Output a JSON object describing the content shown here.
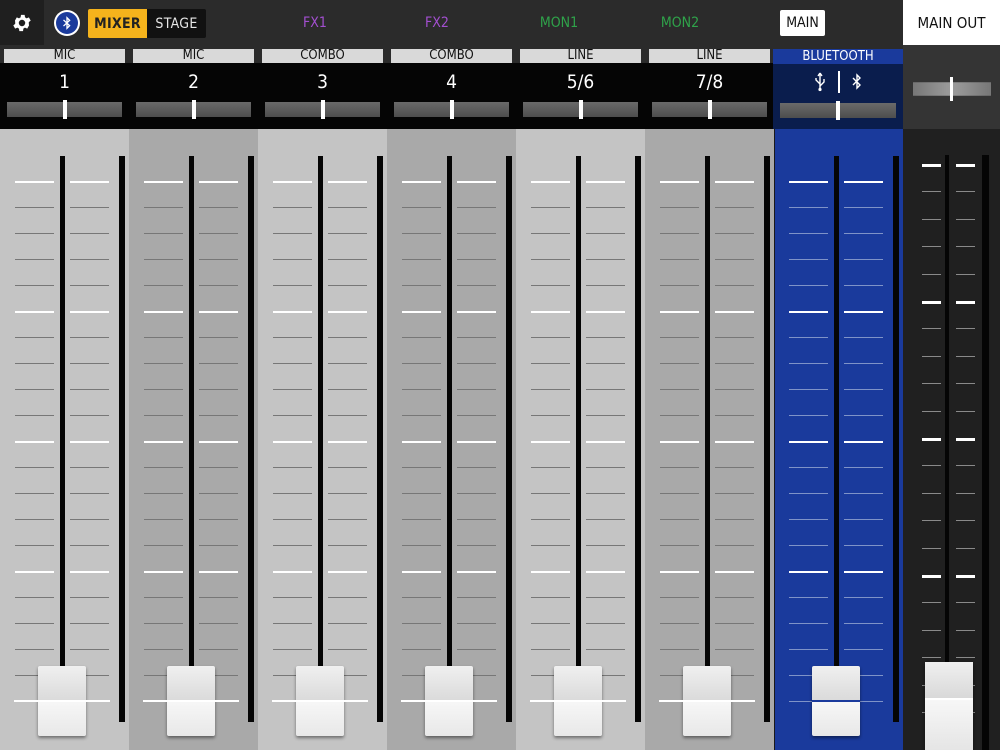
{
  "header": {
    "settings_icon": "gear-icon",
    "bluetooth_icon": "bluetooth-icon",
    "mode": {
      "selected": "MIXER",
      "options": [
        "MIXER",
        "STAGE"
      ]
    },
    "buses": [
      {
        "label": "FX1",
        "color": "#a34fd0"
      },
      {
        "label": "FX2",
        "color": "#a34fd0"
      },
      {
        "label": "MON1",
        "color": "#2fa34a"
      },
      {
        "label": "MON2",
        "color": "#2fa34a"
      },
      {
        "label": "MAIN",
        "color": "#111111",
        "selected": true
      }
    ],
    "main_out_label": "MAIN OUT"
  },
  "channels": [
    {
      "type": "MIC",
      "number": "1",
      "pan": 0.5,
      "fader_level": 0.0
    },
    {
      "type": "MIC",
      "number": "2",
      "pan": 0.5,
      "fader_level": 0.0
    },
    {
      "type": "COMBO",
      "number": "3",
      "pan": 0.5,
      "fader_level": 0.0
    },
    {
      "type": "COMBO",
      "number": "4",
      "pan": 0.5,
      "fader_level": 0.0
    },
    {
      "type": "LINE",
      "number": "5/6",
      "pan": 0.5,
      "fader_level": 0.0
    },
    {
      "type": "LINE",
      "number": "7/8",
      "pan": 0.5,
      "fader_level": 0.0
    }
  ],
  "bluetooth_channel": {
    "type": "BLUETOOTH",
    "icons": [
      "usb-icon",
      "bluetooth-icon"
    ],
    "pan": 0.5,
    "fader_level": 0.0,
    "accent_color": "#1a3a9c"
  },
  "main_out": {
    "pan": 0.5,
    "fader_level": 0.0
  },
  "colors": {
    "strip_light": "#c4c4c4",
    "strip_dark": "#a9a9a9",
    "accent_mixer": "#f5b31c"
  }
}
